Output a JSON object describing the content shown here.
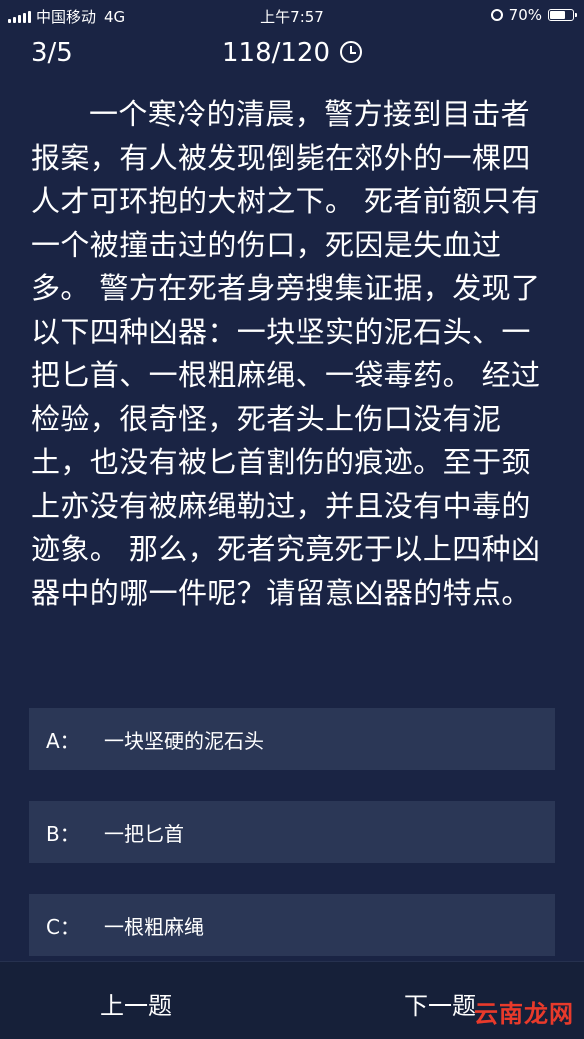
{
  "status_bar": {
    "carrier": "中国移动",
    "network": "4G",
    "time": "上午7:57",
    "battery": "70%"
  },
  "header": {
    "progress": "3/5",
    "timer": "118/120"
  },
  "question": {
    "text": "一个寒冷的清晨，警方接到目击者报案，有人被发现倒毙在郊外的一棵四人才可环抱的大树之下。 死者前额只有一个被撞击过的伤口，死因是失血过多。 警方在死者身旁搜集证据，发现了以下四种凶器：一块坚实的泥石头、一把匕首、一根粗麻绳、一袋毒药。 经过检验，很奇怪，死者头上伤口没有泥土，也没有被匕首割伤的痕迹。至于颈上亦没有被麻绳勒过，并且没有中毒的迹象。 那么，死者究竟死于以上四种凶器中的哪一件呢？请留意凶器的特点。"
  },
  "options": [
    {
      "letter": "A：",
      "text": "一块坚硬的泥石头"
    },
    {
      "letter": "B：",
      "text": "一把匕首"
    },
    {
      "letter": "C：",
      "text": "一根粗麻绳"
    }
  ],
  "nav": {
    "prev": "上一题",
    "next": "下一题"
  },
  "watermark": "云南龙网"
}
